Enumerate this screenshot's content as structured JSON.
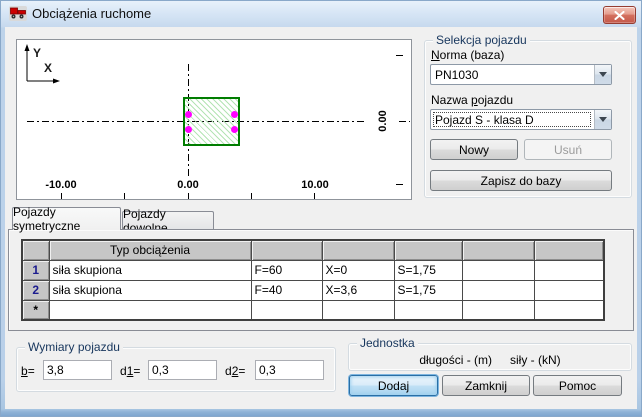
{
  "window": {
    "title": "Obciążenia ruchome"
  },
  "plot": {
    "y_axis_label": "Y",
    "x_axis_label": "X",
    "x_tick_labels": [
      "-10.00",
      "0.00",
      "10.00"
    ],
    "y_tick_label": "0.00"
  },
  "selection": {
    "title": "Selekcja pojazdu",
    "norma_label": {
      "pre": "",
      "u": "N",
      "post": "orma (baza)"
    },
    "norma_value": "PN1030",
    "nazwa_label": {
      "pre": "Nazwa ",
      "u": "p",
      "post": "ojazdu"
    },
    "nazwa_value": "Pojazd S - klasa D",
    "new_button": "Nowy",
    "delete_button": "Usuń",
    "save_button": "Zapisz do bazy"
  },
  "tabs": {
    "symmetric": "Pojazdy symetryczne",
    "free": "Pojazdy dowolne"
  },
  "table": {
    "typ_header": "Typ obciążenia",
    "rows": [
      {
        "num": "1",
        "typ": "siła skupiona",
        "f": "F=60",
        "x": "X=0",
        "s": "S=1,75"
      },
      {
        "num": "2",
        "typ": "siła skupiona",
        "f": "F=40",
        "x": "X=3,6",
        "s": "S=1,75"
      },
      {
        "num": "*",
        "typ": "",
        "f": "",
        "x": "",
        "s": ""
      }
    ]
  },
  "dimensions": {
    "title": "Wymiary pojazdu",
    "b_label": {
      "pre": "",
      "u": "b",
      "post": "="
    },
    "b_value": "3,8",
    "d1_label": {
      "pre": "d",
      "u": "1",
      "post": "="
    },
    "d1_value": "0,3",
    "d2_label": {
      "pre": "d",
      "u": "2",
      "post": "="
    },
    "d2_value": "0,3"
  },
  "unit": {
    "title": "Jednostka",
    "length_text": "długości - (m)",
    "force_text": "siły - (kN)"
  },
  "footer": {
    "add_button": "Dodaj",
    "close_button": "Zamknij",
    "help_button": "Pomoc"
  }
}
